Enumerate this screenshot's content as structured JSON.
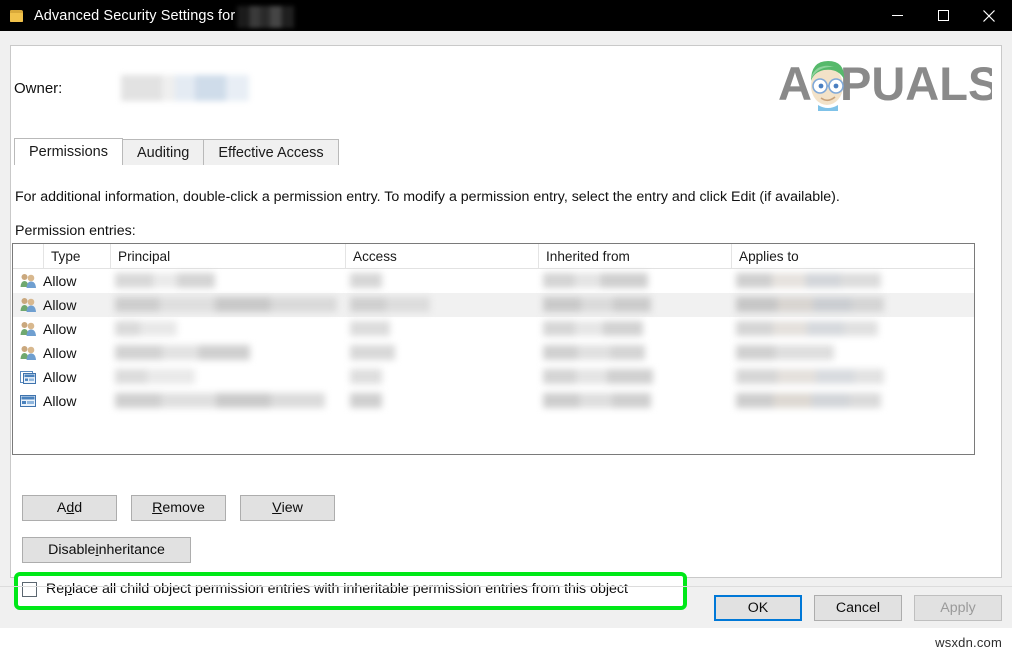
{
  "window": {
    "title": "Advanced Security Settings for",
    "title_redacted": true,
    "icon": "folder-icon",
    "controls": {
      "minimize": "minimize-icon",
      "maximize": "maximize-icon",
      "close": "close-icon"
    }
  },
  "owner": {
    "label": "Owner:",
    "value": ""
  },
  "logo": {
    "text_left": "A",
    "text_right": "PUALS",
    "full": "APPUALS",
    "color": "#8a8a8a",
    "hair_color": "#4caf50"
  },
  "tabs": [
    {
      "label": "Permissions",
      "selected": true
    },
    {
      "label": "Auditing",
      "selected": false
    },
    {
      "label": "Effective Access",
      "selected": false
    }
  ],
  "info_text": "For additional information, double-click a permission entry. To modify a permission entry, select the entry and click Edit (if available).",
  "entries_label": "Permission entries:",
  "table": {
    "columns": [
      "",
      "Type",
      "Principal",
      "Access",
      "Inherited from",
      "Applies to"
    ],
    "rows": [
      {
        "icon": "users-group-icon",
        "type": "Allow",
        "principal": "",
        "access": "",
        "inherited_from": "",
        "applies_to": "",
        "highlighted": false
      },
      {
        "icon": "users-group-icon",
        "type": "Allow",
        "principal": "",
        "access": "",
        "inherited_from": "",
        "applies_to": "",
        "highlighted": true
      },
      {
        "icon": "users-group-icon",
        "type": "Allow",
        "principal": "",
        "access": "",
        "inherited_from": "",
        "applies_to": "",
        "highlighted": false
      },
      {
        "icon": "users-group-icon",
        "type": "Allow",
        "principal": "",
        "access": "",
        "inherited_from": "",
        "applies_to": "",
        "highlighted": false
      },
      {
        "icon": "stacked-windows-icon",
        "type": "Allow",
        "principal": "",
        "access": "",
        "inherited_from": "",
        "applies_to": "",
        "highlighted": false
      },
      {
        "icon": "computer-window-icon",
        "type": "Allow",
        "principal": "",
        "access": "",
        "inherited_from": "",
        "applies_to": "",
        "highlighted": false
      }
    ]
  },
  "buttons": {
    "add": {
      "pre": "A",
      "accel": "d",
      "post": "d"
    },
    "remove": {
      "pre": "",
      "accel": "R",
      "post": "emove"
    },
    "view": {
      "pre": "",
      "accel": "V",
      "post": "iew"
    },
    "disable_inheritance": {
      "pre": "Disable ",
      "accel": "i",
      "post": "nheritance"
    }
  },
  "checkbox": {
    "checked": false,
    "pre": "Re",
    "accel": "p",
    "post": "lace all child object permission entries with inheritable permission entries from this object",
    "highlight_color": "#00e818"
  },
  "footer": {
    "ok": "OK",
    "cancel": "Cancel",
    "apply": "Apply",
    "apply_disabled": true,
    "ok_focused": true
  },
  "watermark": "wsxdn.com"
}
